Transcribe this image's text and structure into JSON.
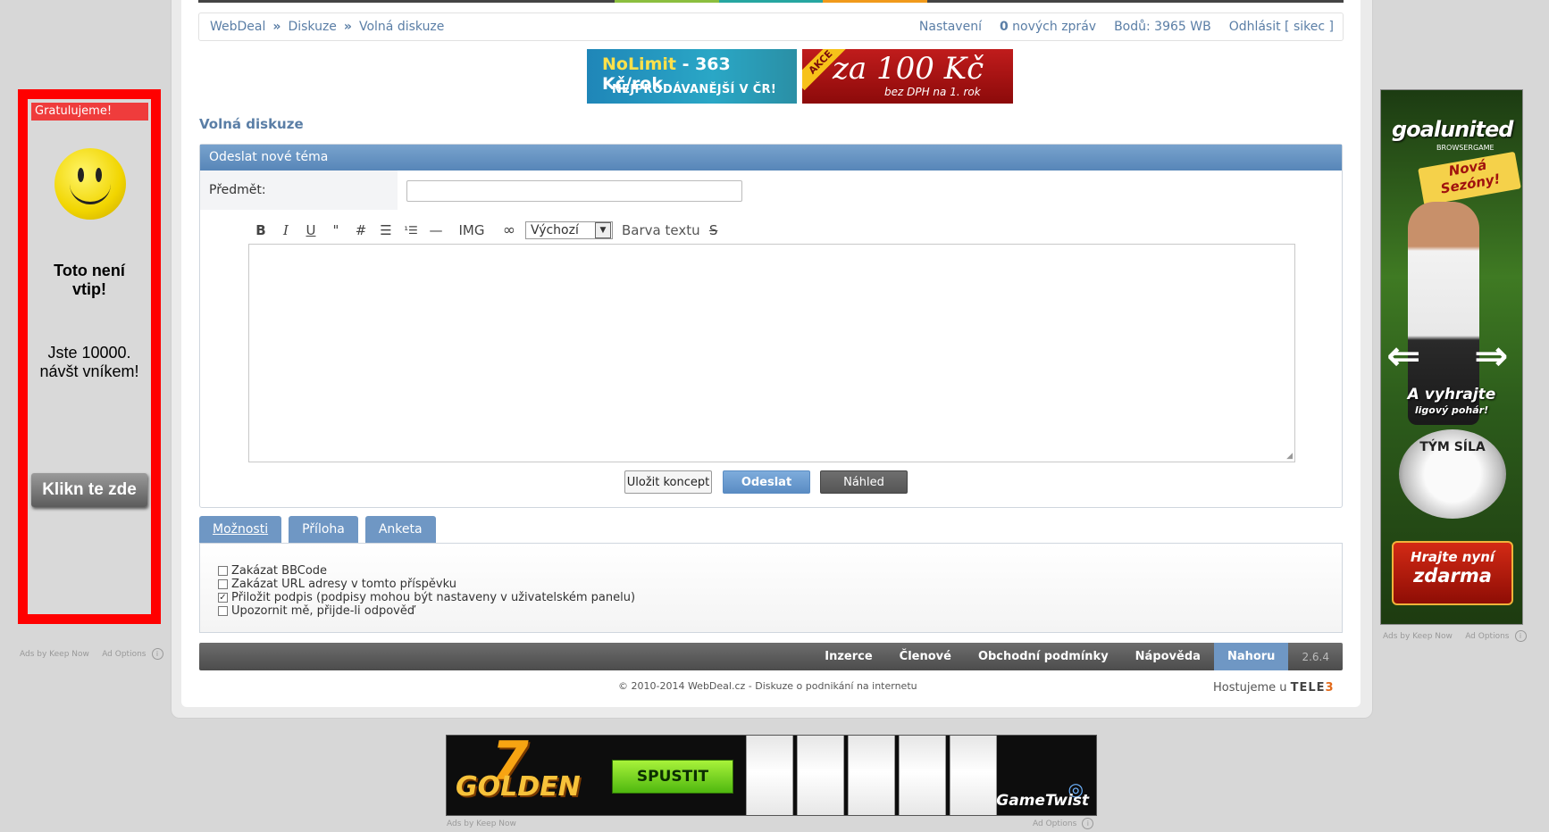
{
  "nav": {
    "crumbs": [
      "WebDeal",
      "Diskuze",
      "Volná diskuze"
    ],
    "separator": "»",
    "settings": "Nastavení",
    "messages_count": "0",
    "messages_text": "nových zpráv",
    "points": "Bodů: 3965 WB",
    "logout": "Odhlásit [ sikec ]"
  },
  "top_strip_colors": [
    "#444444",
    "#444444",
    "#444444",
    "#444444",
    "#8cbf3f",
    "#26a6a1",
    "#f19a1b",
    "#444444",
    "#444444",
    "#444444",
    "#444444"
  ],
  "banners": {
    "nolimit": {
      "line1a": "NoLimit",
      "line1b": " - 363 Kč/rok",
      "line2": "NEJPRODÁVANĚJŠÍ V ČR!"
    },
    "akce": {
      "corner": "AKCE",
      "line1": "za 100 Kč",
      "line2": "bez DPH na 1. rok"
    }
  },
  "section_title": "Volná diskuze",
  "form": {
    "header": "Odeslat nové téma",
    "subject_label": "Předmět:",
    "subject_value": "",
    "toolbar": {
      "bold": "B",
      "italic": "I",
      "underline": "U",
      "quote": "\"",
      "code": "#",
      "list": "☰",
      "ordered_list": "¹☰",
      "hr": "—",
      "img": "IMG",
      "link": "∞",
      "font_select": "Výchozí",
      "color_label": "Barva textu",
      "strike": "S"
    },
    "buttons": {
      "draft": "Uložit koncept",
      "send": "Odeslat",
      "preview": "Náhled"
    }
  },
  "tabs": [
    "Možnosti",
    "Příloha",
    "Anketa"
  ],
  "options": [
    {
      "label": "Zakázat BBCode",
      "checked": false
    },
    {
      "label": "Zakázat URL adresy v tomto příspěvku",
      "checked": false
    },
    {
      "label": "Přiložit podpis (podpisy mohou být nastaveny v uživatelském panelu)",
      "checked": true
    },
    {
      "label": "Upozornit mě, přijde-li odpověď",
      "checked": false
    }
  ],
  "footer": {
    "links": [
      "Inzerce",
      "Členové",
      "Obchodní podmínky",
      "Nápověda"
    ],
    "top": "Nahoru",
    "version": "2.6.4",
    "copyright": "© 2010-2014 WebDeal.cz - Diskuze o podnikání na internetu",
    "hosting_text": "Hostujeme u",
    "hosting_brand": "TELE",
    "hosting_brand_num": "3"
  },
  "left_ad": {
    "heading": "Gratulujeme!",
    "joke_line1": "Toto není",
    "joke_line2": "vtip!",
    "visitor_line1": "Jste 10000.",
    "visitor_line2": "návšt vníkem!",
    "button": "Klikn te zde",
    "ads_by": "Ads by Keep Now",
    "ad_options": "Ad Options"
  },
  "right_ad": {
    "logo": "goalunited",
    "sub": "BROWSERGAME",
    "nova_line1": "Nová",
    "nova_line2": "Sezóny!",
    "win_line1": "A vyhrajte",
    "win_line2": "ligový pohár!",
    "team": "TÝM SÍLA",
    "play_line1": "Hrajte nyní",
    "play_line2": "zdarma",
    "ads_by": "Ads by Keep Now",
    "ad_options": "Ad Options"
  },
  "bottom_ad": {
    "seven": "7",
    "golden": "GOLDEN",
    "button": "SPUSTIT",
    "brand": "GameTwist",
    "ads_by": "Ads by Keep Now",
    "ad_options": "Ad Options"
  }
}
